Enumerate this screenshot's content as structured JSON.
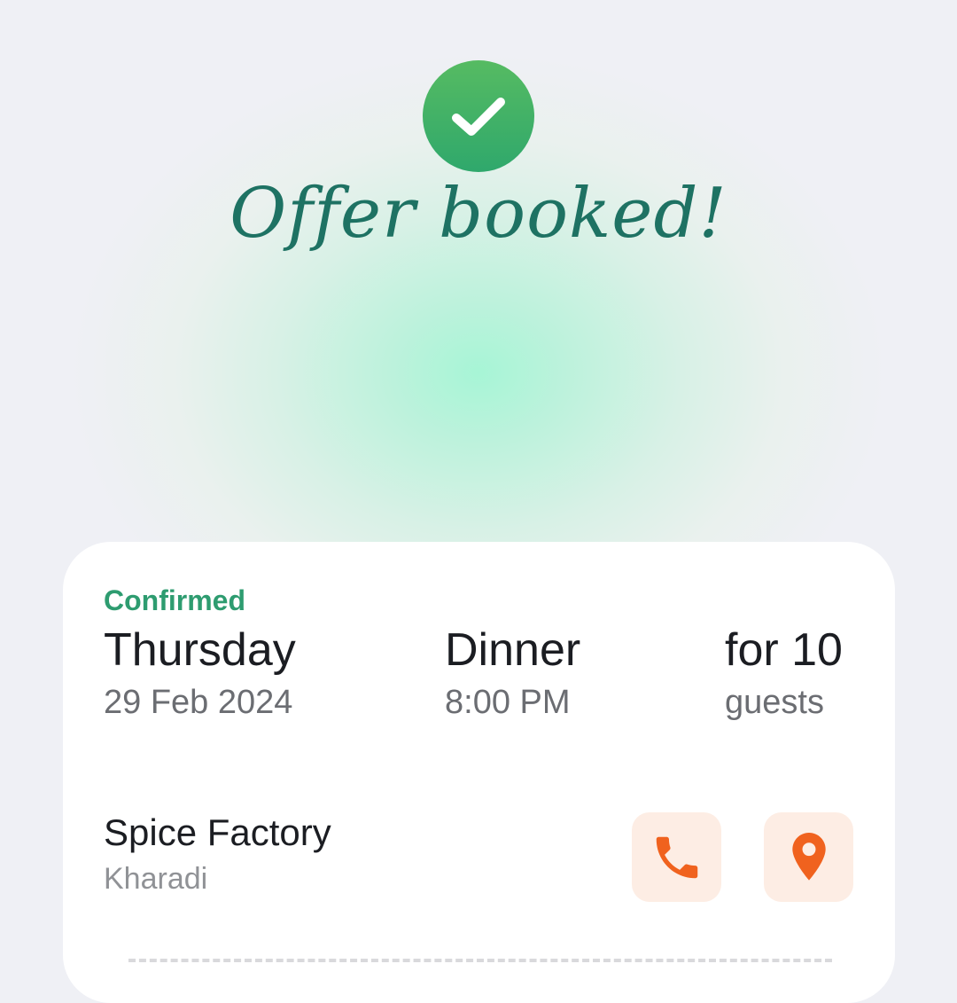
{
  "header": {
    "title": "Offer booked!",
    "icon": "check-icon",
    "accent_color": "#2fa86c"
  },
  "booking": {
    "status": "Confirmed",
    "day": "Thursday",
    "date": "29 Feb 2024",
    "meal": "Dinner",
    "time": "8:00 PM",
    "guests_label": "for 10",
    "guests_unit": "guests"
  },
  "restaurant": {
    "name": "Spice Factory",
    "area": "Kharadi"
  },
  "actions": {
    "call_icon": "phone-icon",
    "map_icon": "map-pin-icon",
    "icon_color": "#f0621e",
    "button_bg": "#fdede4"
  }
}
